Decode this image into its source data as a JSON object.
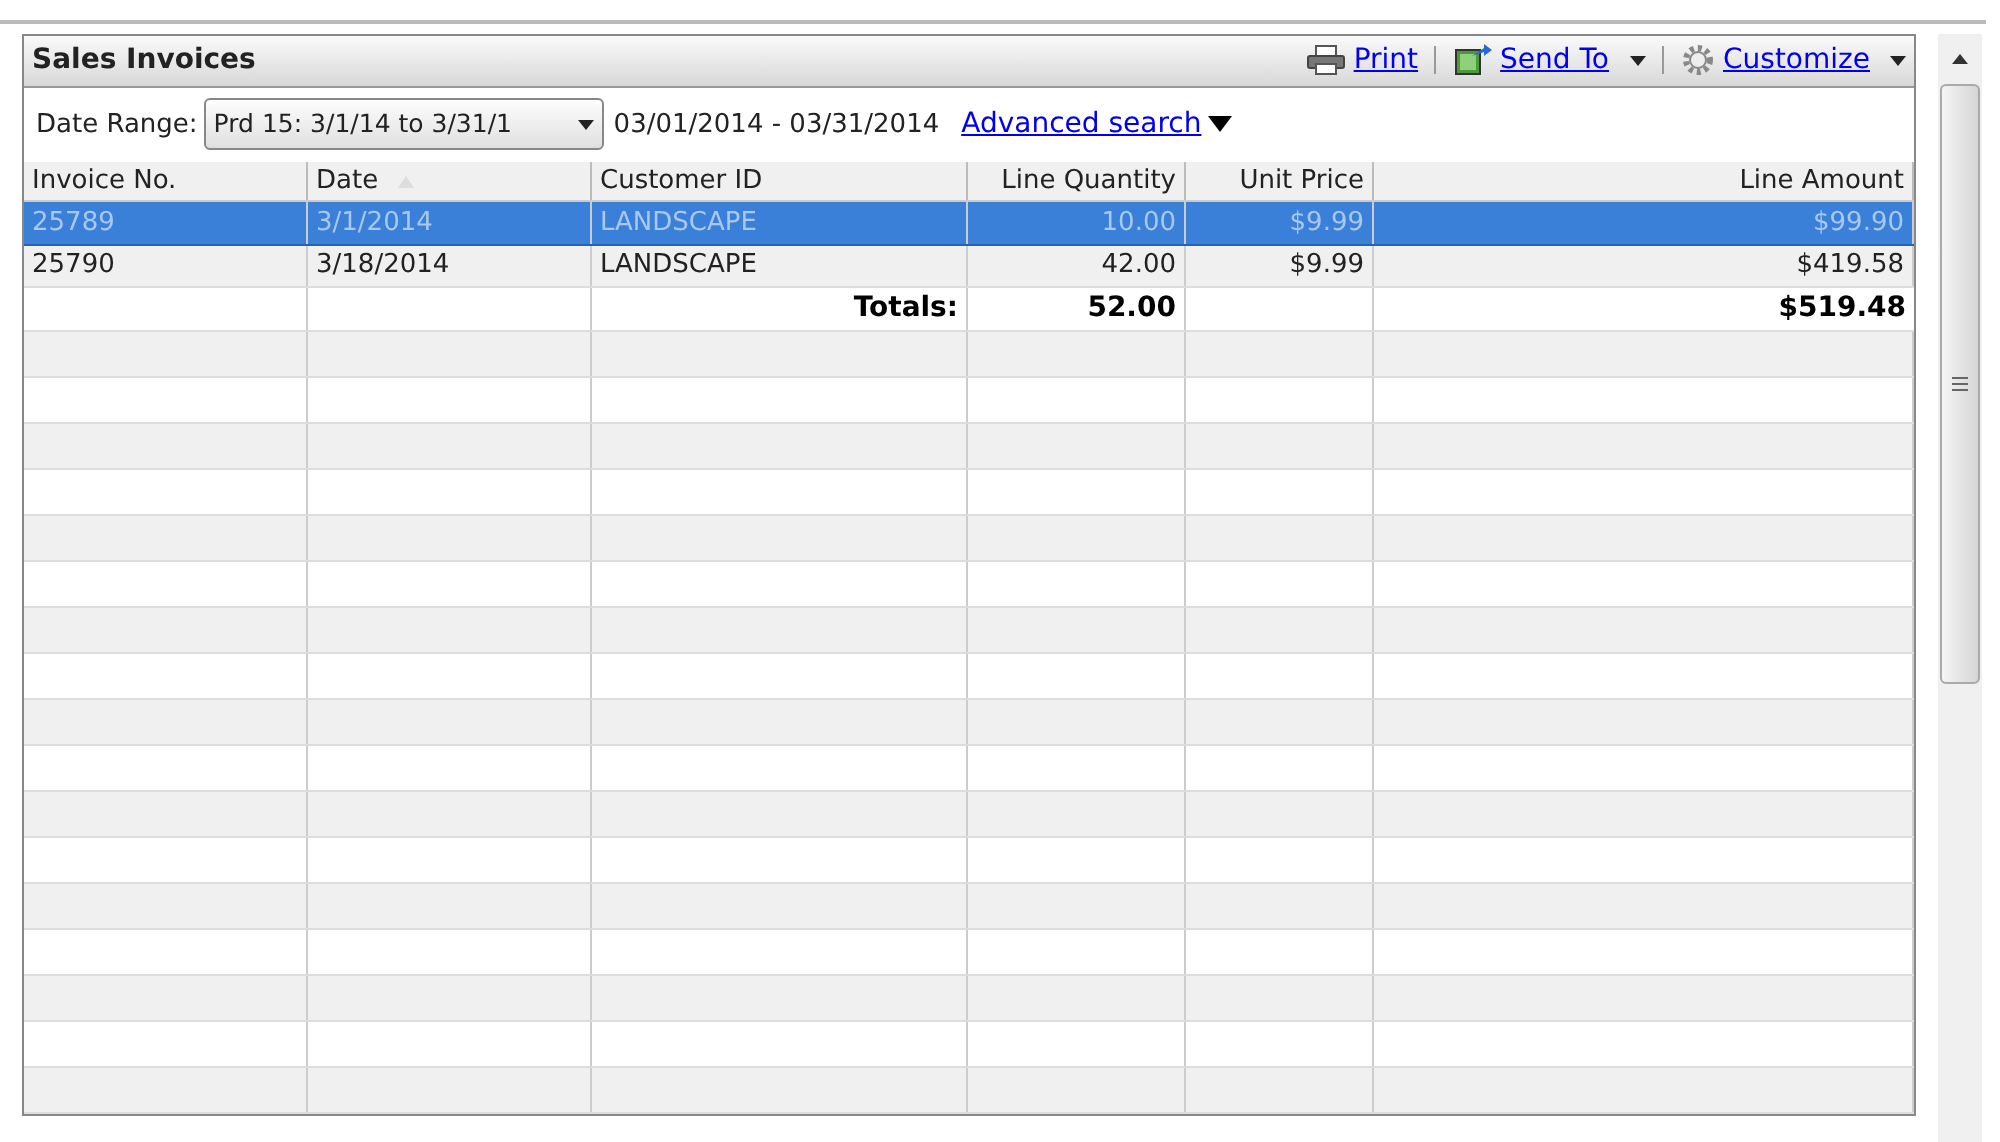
{
  "panel": {
    "title": "Sales Invoices"
  },
  "toolbar": [
    {
      "kind": "print",
      "label": "Print",
      "dropdown": false
    },
    {
      "kind": "send",
      "label": "Send To",
      "dropdown": true
    },
    {
      "kind": "customize",
      "label": "Customize",
      "dropdown": true
    }
  ],
  "filter": {
    "label": "Date Range:",
    "value": "Prd 15: 3/1/14 to 3/31/1",
    "range": "03/01/2014 - 03/31/2014",
    "advanced_link": "Advanced search"
  },
  "table": {
    "columns": [
      {
        "label": "Invoice No.",
        "sorted": false
      },
      {
        "label": "Date",
        "sorted": true
      },
      {
        "label": "Customer ID",
        "sorted": false
      },
      {
        "label": "Line Quantity",
        "sorted": false
      },
      {
        "label": "Unit Price",
        "sorted": false
      },
      {
        "label": "Line Amount",
        "sorted": false
      }
    ],
    "rows": [
      {
        "selected": true,
        "cells": [
          "25789",
          "3/1/2014",
          "LANDSCAPE",
          "10.00",
          "$9.99",
          "$99.90"
        ]
      },
      {
        "selected": false,
        "cells": [
          "25790",
          "3/18/2014",
          "LANDSCAPE",
          "42.00",
          "$9.99",
          "$419.58"
        ]
      }
    ],
    "totals": {
      "label": "Totals:",
      "quantity": "52.00",
      "amount": "$519.48"
    }
  }
}
